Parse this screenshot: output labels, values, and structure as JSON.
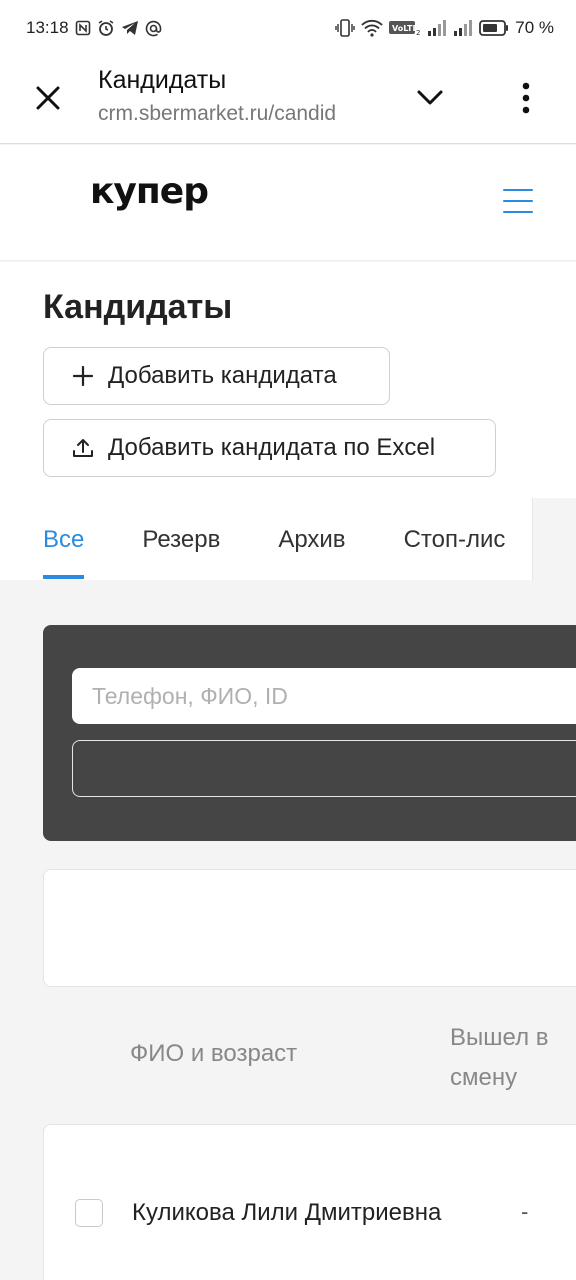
{
  "status_bar": {
    "time": "13:18",
    "battery": "70 %",
    "left_icons": [
      "nfc-icon",
      "alarm-icon",
      "telegram-icon",
      "at-icon"
    ],
    "right_icons": [
      "vibrate-icon",
      "wifi-icon",
      "volte-icon",
      "signal-icon",
      "signal-icon",
      "battery-icon"
    ]
  },
  "browser": {
    "title": "Кандидаты",
    "url": "crm.sbermarket.ru/candid"
  },
  "header": {
    "logo_text": "купер",
    "accent_color": "#2a8be0"
  },
  "page": {
    "title": "Кандидаты",
    "add_button": "Добавить кандидата",
    "add_excel_button": "Добавить кандидата по Excel"
  },
  "tabs": [
    {
      "label": "Все",
      "active": true
    },
    {
      "label": "Резерв",
      "active": false
    },
    {
      "label": "Архив",
      "active": false
    },
    {
      "label": "Стоп-лис",
      "active": false
    }
  ],
  "filters": {
    "search_placeholder": "Телефон, ФИО, ID",
    "select_value": ""
  },
  "table": {
    "columns": [
      "ФИО и возраст",
      "Вышел в смену"
    ],
    "rows": [
      {
        "name": "Куликова Лили Дмитриевна",
        "shift": "-"
      }
    ]
  }
}
